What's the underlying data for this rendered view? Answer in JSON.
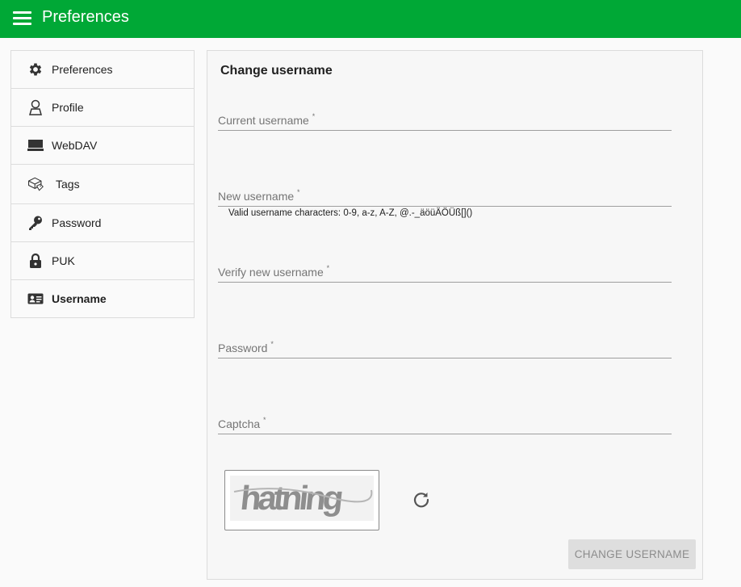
{
  "header": {
    "title": "Preferences",
    "menu_icon": "hamburger-menu-icon",
    "color": "#00a836"
  },
  "sidebar": {
    "items": [
      {
        "label": "Preferences",
        "icon": "gear-icon",
        "active": false
      },
      {
        "label": "Profile",
        "icon": "person-icon",
        "active": false
      },
      {
        "label": "WebDAV",
        "icon": "drive-icon",
        "active": false
      },
      {
        "label": "Tags",
        "icon": "tags-icon",
        "active": false
      },
      {
        "label": "Password",
        "icon": "key-icon",
        "active": false
      },
      {
        "label": "PUK",
        "icon": "lock-icon",
        "active": false
      },
      {
        "label": "Username",
        "icon": "id-card-icon",
        "active": true
      }
    ]
  },
  "form": {
    "title": "Change username",
    "fields": {
      "current_username": {
        "label": "Current username",
        "required": "*",
        "value": ""
      },
      "new_username": {
        "label": "New username",
        "required": "*",
        "value": "",
        "hint": "Valid username characters: 0-9, a-z, A-Z, @.-_äöüÄÖÜß[]()"
      },
      "verify_username": {
        "label": "Verify new username",
        "required": "*",
        "value": ""
      },
      "password": {
        "label": "Password",
        "required": "*",
        "value": ""
      },
      "captcha": {
        "label": "Captcha",
        "required": "*",
        "value": ""
      }
    },
    "captcha_text": "hatning",
    "refresh_icon": "refresh-icon",
    "submit_label": "CHANGE USERNAME"
  }
}
